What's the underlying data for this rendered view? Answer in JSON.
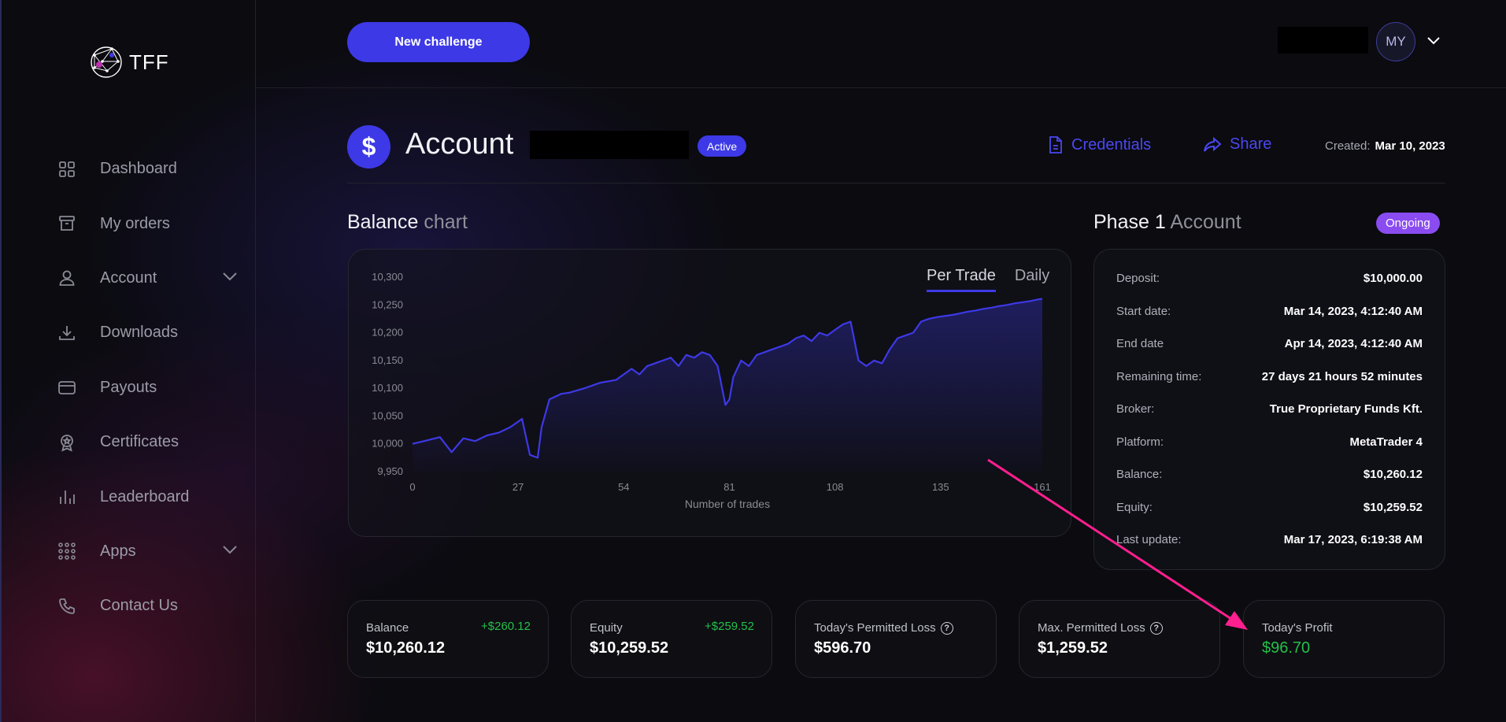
{
  "brand": {
    "name": "TFF"
  },
  "sidebar": {
    "items": [
      {
        "label": "Dashboard",
        "icon": "grid-icon"
      },
      {
        "label": "My orders",
        "icon": "archive-icon"
      },
      {
        "label": "Account",
        "icon": "user-icon",
        "expandable": true
      },
      {
        "label": "Downloads",
        "icon": "download-icon"
      },
      {
        "label": "Payouts",
        "icon": "wallet-icon"
      },
      {
        "label": "Certificates",
        "icon": "award-icon"
      },
      {
        "label": "Leaderboard",
        "icon": "bar-chart-icon"
      },
      {
        "label": "Apps",
        "icon": "apps-grid-icon",
        "expandable": true
      },
      {
        "label": "Contact Us",
        "icon": "phone-icon"
      }
    ]
  },
  "header": {
    "new_challenge": "New challenge",
    "avatar_initials": "MY"
  },
  "account": {
    "icon": "$",
    "title": "Account",
    "status": "Active",
    "credentials": "Credentials",
    "share": "Share",
    "created_label": "Created:",
    "created_value": "Mar 10, 2023"
  },
  "balance_section": {
    "title_main": "Balance",
    "title_sub": "chart"
  },
  "chart_tabs": {
    "per_trade": "Per Trade",
    "daily": "Daily"
  },
  "chart_data": {
    "type": "area",
    "xlabel": "Number of trades",
    "ylabel": "",
    "xlim": [
      0,
      161
    ],
    "ylim": [
      9950,
      10300
    ],
    "x_ticks": [
      0,
      27,
      54,
      81,
      108,
      135,
      161
    ],
    "y_ticks": [
      10300,
      10250,
      10200,
      10150,
      10100,
      10050,
      10000,
      9950
    ],
    "y_tick_labels": [
      "10,300",
      "10,250",
      "10,200",
      "10,150",
      "10,100",
      "10,050",
      "10,000",
      "9,950"
    ],
    "color": "#3d39e6",
    "series": [
      {
        "x": [
          0,
          3,
          7,
          10,
          13,
          16,
          19,
          22,
          25,
          27,
          28,
          30,
          32,
          33,
          35,
          38,
          40,
          44,
          48,
          52,
          54,
          56,
          58,
          60,
          62,
          64,
          66,
          68,
          70,
          72,
          74,
          76,
          78,
          80,
          81,
          82,
          84,
          86,
          88,
          90,
          92,
          94,
          96,
          98,
          100,
          102,
          104,
          106,
          108,
          110,
          112,
          114,
          116,
          118,
          120,
          122,
          124,
          126,
          128,
          130,
          132,
          134,
          136,
          138,
          140,
          142,
          144,
          146,
          148,
          150,
          152,
          154,
          156,
          158,
          160,
          161
        ],
        "y": [
          10000,
          10005,
          10012,
          9985,
          10010,
          10005,
          10015,
          10020,
          10030,
          10040,
          10045,
          9980,
          9975,
          10030,
          10080,
          10090,
          10092,
          10100,
          10110,
          10115,
          10125,
          10135,
          10125,
          10140,
          10145,
          10150,
          10155,
          10140,
          10160,
          10155,
          10165,
          10160,
          10140,
          10070,
          10080,
          10120,
          10150,
          10140,
          10160,
          10165,
          10170,
          10175,
          10180,
          10190,
          10195,
          10185,
          10200,
          10195,
          10205,
          10215,
          10220,
          10150,
          10140,
          10150,
          10145,
          10170,
          10190,
          10195,
          10200,
          10220,
          10225,
          10228,
          10230,
          10232,
          10235,
          10238,
          10240,
          10243,
          10245,
          10248,
          10250,
          10253,
          10255,
          10257,
          10260,
          10261
        ]
      }
    ]
  },
  "phase": {
    "title_main": "Phase 1",
    "title_sub": "Account",
    "status": "Ongoing",
    "rows": [
      {
        "k": "Deposit:",
        "v": "$10,000.00"
      },
      {
        "k": "Start date:",
        "v": "Mar 14, 2023, 4:12:40 AM"
      },
      {
        "k": "End date",
        "v": "Apr 14, 2023, 4:12:40 AM"
      },
      {
        "k": "Remaining time:",
        "v": "27 days 21 hours 52 minutes"
      },
      {
        "k": "Broker:",
        "v": "True Proprietary Funds Kft."
      },
      {
        "k": "Platform:",
        "v": "MetaTrader 4"
      },
      {
        "k": "Balance:",
        "v": "$10,260.12"
      },
      {
        "k": "Equity:",
        "v": "$10,259.52"
      },
      {
        "k": "Last update:",
        "v": "Mar 17, 2023, 6:19:38 AM"
      }
    ]
  },
  "stats": [
    {
      "label": "Balance",
      "value": "$10,260.12",
      "delta": "+$260.12"
    },
    {
      "label": "Equity",
      "value": "$10,259.52",
      "delta": "+$259.52"
    },
    {
      "label": "Today's Permitted Loss",
      "value": "$596.70",
      "help": "?"
    },
    {
      "label": "Max. Permitted Loss",
      "value": "$1,259.52",
      "help": "?"
    },
    {
      "label": "Today's Profit",
      "value": "$96.70"
    }
  ],
  "colors": {
    "accent": "#3d39e6",
    "ongoing": "#8a4cf0",
    "positive": "#25c04a",
    "annotation_arrow": "#ff1f8e"
  }
}
